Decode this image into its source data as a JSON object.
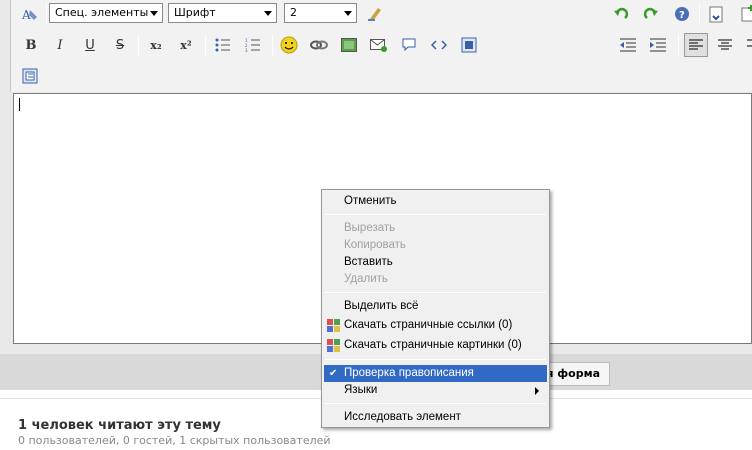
{
  "toolbar": {
    "special_elements_value": "Спец. элементы",
    "font_value": "Шрифт",
    "size_value": "2",
    "bold_label": "B",
    "italic_label": "I",
    "underline_label": "U",
    "strike_label": "S",
    "subscript_label": "x₂",
    "superscript_label": "x²"
  },
  "form_button": {
    "label": "я форма"
  },
  "readers": {
    "title": "1 человек читают эту тему",
    "subtitle": "0 пользователей, 0 гостей, 1 скрытых пользователей"
  },
  "context_menu": {
    "undo": "Отменить",
    "cut": "Вырезать",
    "copy": "Копировать",
    "paste": "Вставить",
    "delete": "Удалить",
    "select_all": "Выделить всё",
    "download_links": "Скачать страничные ссылки (0)",
    "download_images": "Скачать страничные картинки (0)",
    "spellcheck": "Проверка правописания",
    "languages": "Языки",
    "inspect": "Исследовать элемент"
  },
  "colors": {
    "highlight": "#316ac5",
    "menu_bg": "#f0f0f0",
    "disabled_text": "#a0a0a0"
  }
}
